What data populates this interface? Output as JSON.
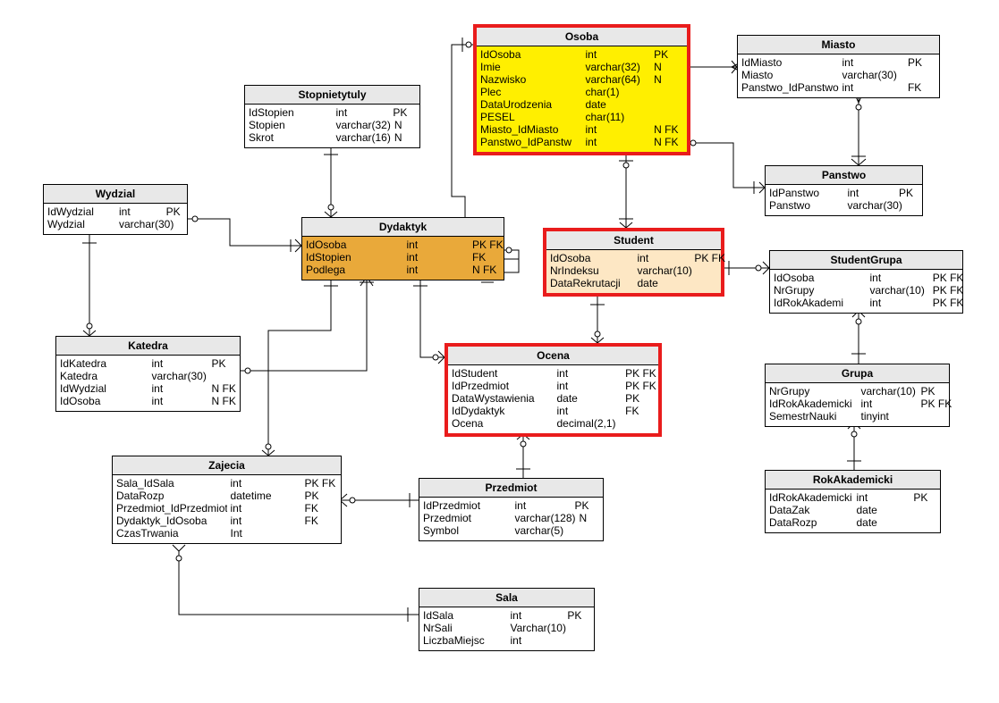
{
  "entities": {
    "osoba": {
      "title": "Osoba",
      "rows": [
        {
          "name": "IdOsoba",
          "type": "int",
          "keys": "PK"
        },
        {
          "name": "Imie",
          "type": "varchar(32)",
          "keys": "N"
        },
        {
          "name": "Nazwisko",
          "type": "varchar(64)",
          "keys": "N"
        },
        {
          "name": "Plec",
          "type": "char(1)",
          "keys": ""
        },
        {
          "name": "DataUrodzenia",
          "type": "date",
          "keys": ""
        },
        {
          "name": "PESEL",
          "type": "char(11)",
          "keys": ""
        },
        {
          "name": "Miasto_IdMiasto",
          "type": "int",
          "keys": "N FK"
        },
        {
          "name": "Panstwo_IdPanstw",
          "type": "int",
          "keys": "N FK"
        }
      ]
    },
    "miasto": {
      "title": "Miasto",
      "rows": [
        {
          "name": "IdMiasto",
          "type": "int",
          "keys": "PK"
        },
        {
          "name": "Miasto",
          "type": "varchar(30)",
          "keys": ""
        },
        {
          "name": "Panstwo_IdPanstwo",
          "type": "int",
          "keys": "FK"
        }
      ]
    },
    "stopnietytuly": {
      "title": "Stopnietytuly",
      "rows": [
        {
          "name": "IdStopien",
          "type": "int",
          "keys": "PK"
        },
        {
          "name": "Stopien",
          "type": "varchar(32)",
          "keys": "N"
        },
        {
          "name": "Skrot",
          "type": "varchar(16)",
          "keys": "N"
        }
      ]
    },
    "wydzial": {
      "title": "Wydzial",
      "rows": [
        {
          "name": "IdWydzial",
          "type": "int",
          "keys": "PK"
        },
        {
          "name": "Wydzial",
          "type": "varchar(30)",
          "keys": ""
        }
      ]
    },
    "panstwo": {
      "title": "Panstwo",
      "rows": [
        {
          "name": "IdPanstwo",
          "type": "int",
          "keys": "PK"
        },
        {
          "name": "Panstwo",
          "type": "varchar(30)",
          "keys": ""
        }
      ]
    },
    "dydaktyk": {
      "title": "Dydaktyk",
      "rows": [
        {
          "name": "IdOsoba",
          "type": "int",
          "keys": "PK FK"
        },
        {
          "name": "IdStopien",
          "type": "int",
          "keys": "FK"
        },
        {
          "name": "Podlega",
          "type": "int",
          "keys": "N FK"
        }
      ]
    },
    "student": {
      "title": "Student",
      "rows": [
        {
          "name": "IdOsoba",
          "type": "int",
          "keys": "PK FK"
        },
        {
          "name": "NrIndeksu",
          "type": "varchar(10)",
          "keys": ""
        },
        {
          "name": "DataRekrutacji",
          "type": "date",
          "keys": ""
        }
      ]
    },
    "studentgrupa": {
      "title": "StudentGrupa",
      "rows": [
        {
          "name": "IdOsoba",
          "type": "int",
          "keys": "PK FK"
        },
        {
          "name": "NrGrupy",
          "type": "varchar(10)",
          "keys": "PK FK"
        },
        {
          "name": "IdRokAkademi",
          "type": "int",
          "keys": "PK FK"
        }
      ]
    },
    "katedra": {
      "title": "Katedra",
      "rows": [
        {
          "name": "IdKatedra",
          "type": "int",
          "keys": "PK"
        },
        {
          "name": "Katedra",
          "type": "varchar(30)",
          "keys": ""
        },
        {
          "name": "IdWydzial",
          "type": "int",
          "keys": "N FK"
        },
        {
          "name": "IdOsoba",
          "type": "int",
          "keys": "N FK"
        }
      ]
    },
    "ocena": {
      "title": "Ocena",
      "rows": [
        {
          "name": "IdStudent",
          "type": "int",
          "keys": "PK FK"
        },
        {
          "name": "IdPrzedmiot",
          "type": "int",
          "keys": "PK FK"
        },
        {
          "name": "DataWystawienia",
          "type": "date",
          "keys": "PK"
        },
        {
          "name": "IdDydaktyk",
          "type": "int",
          "keys": "FK"
        },
        {
          "name": "Ocena",
          "type": "decimal(2,1)",
          "keys": ""
        }
      ]
    },
    "grupa": {
      "title": "Grupa",
      "rows": [
        {
          "name": "NrGrupy",
          "type": "varchar(10)",
          "keys": "PK"
        },
        {
          "name": "IdRokAkademicki",
          "type": "int",
          "keys": "PK FK"
        },
        {
          "name": "SemestrNauki",
          "type": "tinyint",
          "keys": ""
        }
      ]
    },
    "zajecia": {
      "title": "Zajecia",
      "rows": [
        {
          "name": "Sala_IdSala",
          "type": "int",
          "keys": "PK FK"
        },
        {
          "name": "DataRozp",
          "type": "datetime",
          "keys": "PK"
        },
        {
          "name": "Przedmiot_IdPrzedmiot",
          "type": "int",
          "keys": "FK"
        },
        {
          "name": "Dydaktyk_IdOsoba",
          "type": "int",
          "keys": "FK"
        },
        {
          "name": "CzasTrwania",
          "type": "Int",
          "keys": ""
        }
      ]
    },
    "przedmiot": {
      "title": "Przedmiot",
      "rows": [
        {
          "name": "IdPrzedmiot",
          "type": "int",
          "keys": "PK"
        },
        {
          "name": "Przedmiot",
          "type": "varchar(128)",
          "keys": "N"
        },
        {
          "name": "Symbol",
          "type": "varchar(5)",
          "keys": ""
        }
      ]
    },
    "rokakademicki": {
      "title": "RokAkademicki",
      "rows": [
        {
          "name": "IdRokAkademicki",
          "type": "int",
          "keys": "PK"
        },
        {
          "name": "DataZak",
          "type": "date",
          "keys": ""
        },
        {
          "name": "DataRozp",
          "type": "date",
          "keys": ""
        }
      ]
    },
    "sala": {
      "title": "Sala",
      "rows": [
        {
          "name": "IdSala",
          "type": "int",
          "keys": "PK"
        },
        {
          "name": "NrSali",
          "type": "Varchar(10)",
          "keys": ""
        },
        {
          "name": "LiczbaMiejsc",
          "type": "int",
          "keys": ""
        }
      ]
    }
  }
}
